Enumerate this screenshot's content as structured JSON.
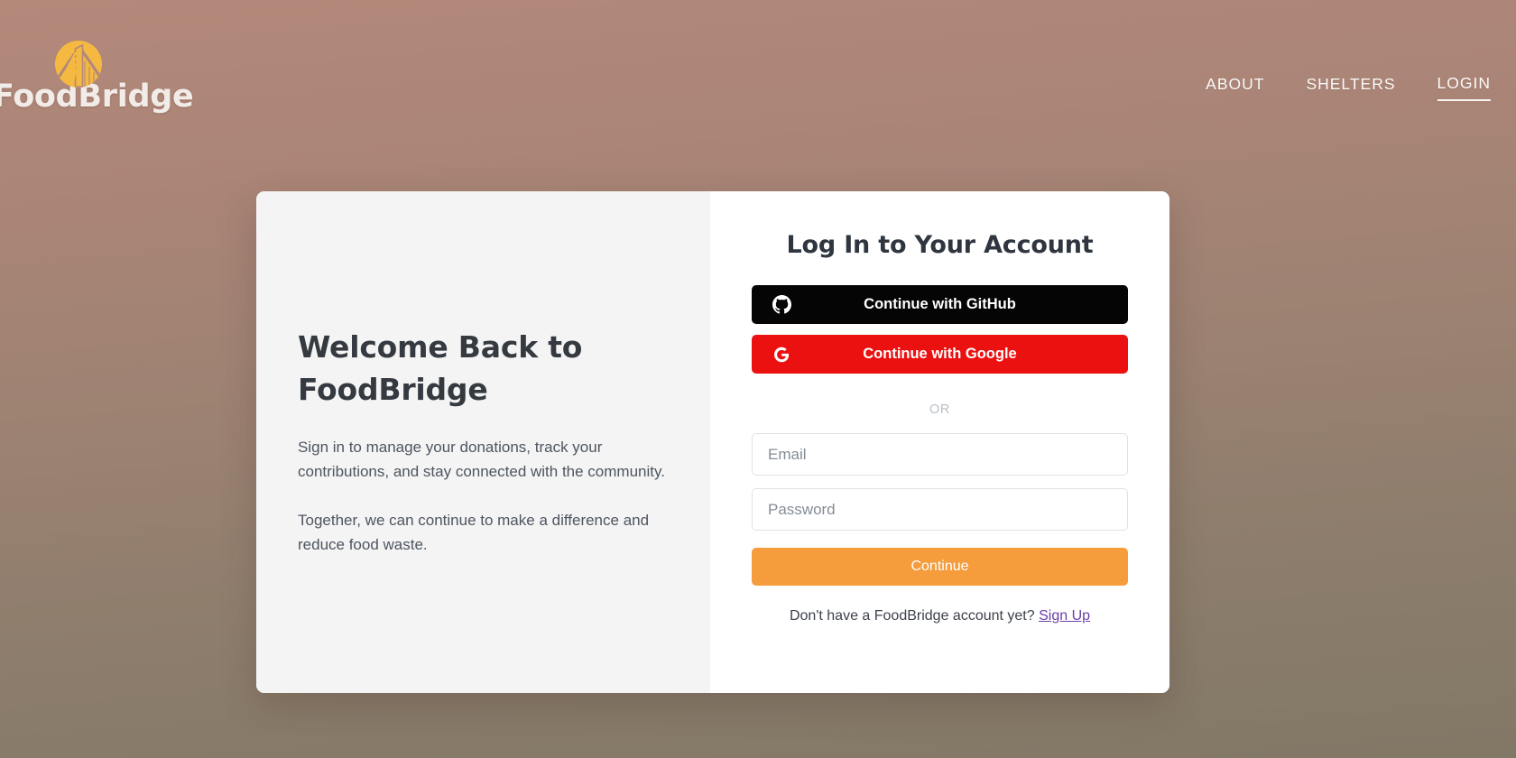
{
  "header": {
    "brand_name": "FoodBridge",
    "logo_icon": "bridge-sun-logo-icon",
    "nav": [
      {
        "label": "ABOUT",
        "name": "nav-link-about",
        "active": false
      },
      {
        "label": "SHELTERS",
        "name": "nav-link-shelters",
        "active": false
      },
      {
        "label": "LOGIN",
        "name": "nav-link-login",
        "active": true
      }
    ]
  },
  "card": {
    "left": {
      "title": "Welcome Back to FoodBridge",
      "paragraph_1": "Sign in to manage your donations, track your contributions, and stay connected with the community.",
      "paragraph_2": "Together, we can continue to make a difference and reduce food waste."
    },
    "right": {
      "form_title": "Log In to Your Account",
      "github_button": {
        "label": "Continue with GitHub",
        "icon": "github-icon"
      },
      "google_button": {
        "label": "Continue with Google",
        "icon": "google-icon"
      },
      "divider_label": "OR",
      "email_placeholder": "Email",
      "email_value": "",
      "password_placeholder": "Password",
      "password_value": "",
      "continue_label": "Continue",
      "signup_prompt": "Don't have a FoodBridge account yet?",
      "signup_link_label": "Sign Up"
    }
  },
  "colors": {
    "background_top": "#b3897a",
    "background_bottom": "#827866",
    "accent_orange": "#f59c3c",
    "logo_orange": "#f5b942",
    "github_black": "#050505",
    "google_red": "#ec1111",
    "link_purple": "#6a3fa8",
    "panel_gray": "#f4f4f4"
  }
}
